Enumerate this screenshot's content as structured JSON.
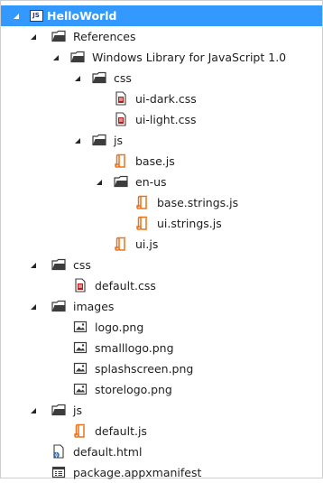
{
  "tree": [
    {
      "label": "HelloWorld",
      "icon": "js-project-icon",
      "icon_text": "JS",
      "expanded": true,
      "selected": true
    },
    {
      "label": "References",
      "icon": "folder-icon",
      "expanded": true
    },
    {
      "label": "Windows Library for JavaScript 1.0",
      "icon": "folder-icon",
      "expanded": true
    },
    {
      "label": "css",
      "icon": "folder-icon",
      "expanded": true
    },
    {
      "label": "ui-dark.css",
      "icon": "css-file-icon"
    },
    {
      "label": "ui-light.css",
      "icon": "css-file-icon"
    },
    {
      "label": "js",
      "icon": "folder-icon",
      "expanded": true
    },
    {
      "label": "base.js",
      "icon": "js-file-icon"
    },
    {
      "label": "en-us",
      "icon": "folder-icon",
      "expanded": true
    },
    {
      "label": "base.strings.js",
      "icon": "js-file-icon"
    },
    {
      "label": "ui.strings.js",
      "icon": "js-file-icon"
    },
    {
      "label": "ui.js",
      "icon": "js-file-icon"
    },
    {
      "label": "css",
      "icon": "folder-icon",
      "expanded": true
    },
    {
      "label": "default.css",
      "icon": "css-file-icon"
    },
    {
      "label": "images",
      "icon": "folder-icon",
      "expanded": true
    },
    {
      "label": "logo.png",
      "icon": "image-file-icon"
    },
    {
      "label": "smalllogo.png",
      "icon": "image-file-icon"
    },
    {
      "label": "splashscreen.png",
      "icon": "image-file-icon"
    },
    {
      "label": "storelogo.png",
      "icon": "image-file-icon"
    },
    {
      "label": "js",
      "icon": "folder-icon",
      "expanded": true
    },
    {
      "label": "default.js",
      "icon": "js-file-icon"
    },
    {
      "label": "default.html",
      "icon": "html-file-icon"
    },
    {
      "label": "package.appxmanifest",
      "icon": "manifest-file-icon"
    }
  ],
  "colors": {
    "selection": "#3399ff",
    "js_file": "#e8731c",
    "css_file": "#b51c1c",
    "folder": "#3c3c3c",
    "html_file": "#1f5fa8"
  }
}
